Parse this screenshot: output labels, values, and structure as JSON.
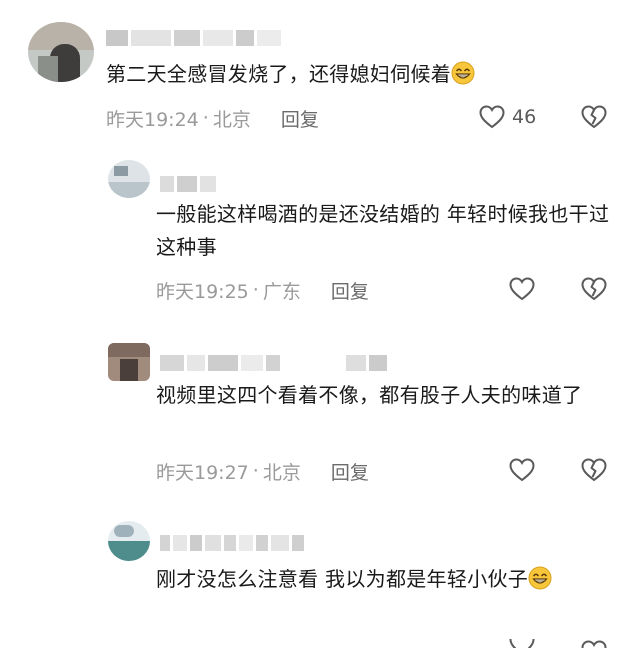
{
  "comments": [
    {
      "text": "第二天全感冒发烧了，还得媳妇伺候着",
      "emoji": "grinning-face",
      "time": "昨天19:24",
      "location": "北京",
      "reply": "回复",
      "likes": "46"
    },
    {
      "text": "一般能这样喝酒的是还没结婚的 年轻时候我也干过这种事",
      "time": "昨天19:25",
      "location": "广东",
      "reply": "回复",
      "likes": ""
    },
    {
      "text": "视频里这四个看着不像，都有股子人夫的味道了",
      "time": "昨天19:27",
      "location": "北京",
      "reply": "回复",
      "likes": ""
    },
    {
      "text": "刚才没怎么注意看 我以为都是年轻小伙子",
      "emoji": "grinning-face",
      "time": "",
      "location": "",
      "reply": "",
      "likes": ""
    }
  ],
  "colors": {
    "text": "#1a1a1a",
    "meta": "#9a9a9a",
    "reply": "#6b6b6b",
    "icon": "#5a5a5a",
    "emoji": "#f7c63b"
  },
  "icons": [
    "heart-outline-icon",
    "broken-heart-icon",
    "grinning-face-emoji"
  ]
}
